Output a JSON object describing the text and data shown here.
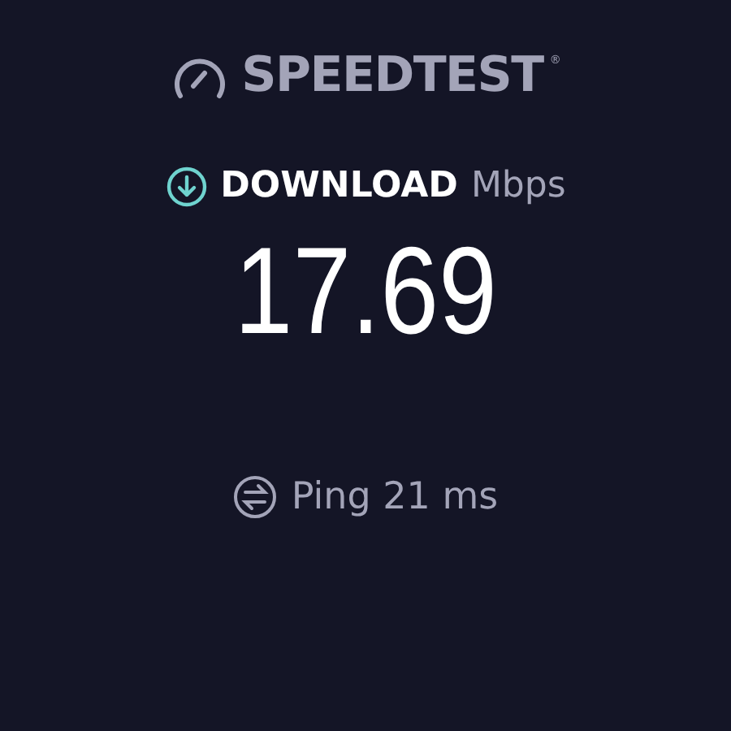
{
  "logo": {
    "text": "SPEEDTEST",
    "mark": "®"
  },
  "metric": {
    "label": "DOWNLOAD",
    "unit": "Mbps",
    "value": "17.69"
  },
  "ping": {
    "label": "Ping 21 ms"
  }
}
